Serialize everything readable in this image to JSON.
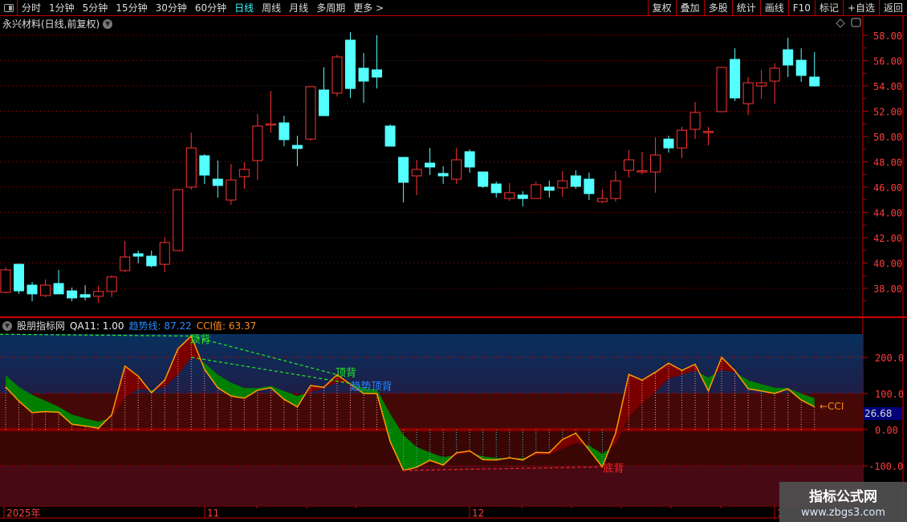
{
  "toolbar": {
    "periods": [
      "分时",
      "1分钟",
      "5分钟",
      "15分钟",
      "30分钟",
      "60分钟",
      "日线",
      "周线",
      "月线",
      "多周期",
      "更多 >"
    ],
    "active_period": "日线",
    "buttons": [
      "复权",
      "叠加",
      "多股",
      "统计",
      "画线",
      "F10",
      "标记",
      "+自选",
      "返回"
    ]
  },
  "main": {
    "title": "永兴材料(日线,前复权)"
  },
  "indicator": {
    "name": "股朋指标网",
    "qa_label": "QA11: 1.00",
    "trend_label": "趋势线: 87.22",
    "cci_label": "CCI值: 63.37",
    "cci_tag": "←CCI",
    "cursor_value": "26.68"
  },
  "xaxis": {
    "labels": [
      "2025年",
      "11",
      "12",
      "1"
    ]
  },
  "watermark": {
    "title": "指标公式网",
    "url": "www.zbgs3.com"
  },
  "colors": {
    "up": "#ff3333",
    "down": "#54ffff",
    "trend_up_fill": "#7a0000",
    "trend_down_fill": "#008000",
    "cci_line": "#ff9900"
  },
  "chart_data": [
    {
      "type": "candlestick",
      "title": "永兴材料(日线,前复权)",
      "ylim": [
        36,
        59
      ],
      "yticks": [
        38,
        40,
        42,
        44,
        46,
        48,
        50,
        52,
        54,
        56,
        58
      ],
      "ytick_labels": [
        "38.00",
        "40.00",
        "42.00",
        "44.00",
        "46.00",
        "48.00",
        "50.00",
        "52.00",
        "54.00",
        "56.00",
        "58.00"
      ],
      "ohlc": [
        [
          37.68,
          39.65,
          37.6,
          39.46
        ],
        [
          39.9,
          39.97,
          37.56,
          37.8
        ],
        [
          38.25,
          38.5,
          36.98,
          37.56
        ],
        [
          37.43,
          38.7,
          37.3,
          38.25
        ],
        [
          38.38,
          39.46,
          37.56,
          37.56
        ],
        [
          37.8,
          38.06,
          36.98,
          37.24
        ],
        [
          37.5,
          38.25,
          37.05,
          37.3
        ],
        [
          37.37,
          38.2,
          36.86,
          37.75
        ],
        [
          37.75,
          39.02,
          37.3,
          38.9
        ],
        [
          39.4,
          41.75,
          39.27,
          40.48
        ],
        [
          40.73,
          40.98,
          39.97,
          40.54
        ],
        [
          40.54,
          40.98,
          39.65,
          39.78
        ],
        [
          39.9,
          42.06,
          39.27,
          41.62
        ],
        [
          40.98,
          45.8,
          40.92,
          45.8
        ],
        [
          46.0,
          50.3,
          45.8,
          49.1
        ],
        [
          48.48,
          48.6,
          46.25,
          46.95
        ],
        [
          46.63,
          48.1,
          45.17,
          46.13
        ],
        [
          44.98,
          47.84,
          44.6,
          46.57
        ],
        [
          46.83,
          47.97,
          45.87,
          47.4
        ],
        [
          48.1,
          51.78,
          46.57,
          50.83
        ],
        [
          50.9,
          53.6,
          50.3,
          51.0
        ],
        [
          51.08,
          51.65,
          49.24,
          49.75
        ],
        [
          49.3,
          50.06,
          47.65,
          49.05
        ],
        [
          49.8,
          53.94,
          49.68,
          53.94
        ],
        [
          53.68,
          55.46,
          51.65,
          51.65
        ],
        [
          53.43,
          56.48,
          53.17,
          56.29
        ],
        [
          57.62,
          58.25,
          53.05,
          53.8
        ],
        [
          55.4,
          56.6,
          52.67,
          54.38
        ],
        [
          55.27,
          58.0,
          53.8,
          54.7
        ],
        [
          50.83,
          50.95,
          49.24,
          49.24
        ],
        [
          48.35,
          48.35,
          44.79,
          46.38
        ],
        [
          46.89,
          48.16,
          45.37,
          47.4
        ],
        [
          47.9,
          49.1,
          46.95,
          47.59
        ],
        [
          47.08,
          47.65,
          46.25,
          46.89
        ],
        [
          46.63,
          49.1,
          46.25,
          48.16
        ],
        [
          48.8,
          48.98,
          47.14,
          47.59
        ],
        [
          47.2,
          47.2,
          45.94,
          46.06
        ],
        [
          46.25,
          46.44,
          45.17,
          45.56
        ],
        [
          45.1,
          46.32,
          44.92,
          45.56
        ],
        [
          45.37,
          45.68,
          44.48,
          45.1
        ],
        [
          45.1,
          46.44,
          45.1,
          46.19
        ],
        [
          46.0,
          46.5,
          45.17,
          45.75
        ],
        [
          45.94,
          47.27,
          45.24,
          46.5
        ],
        [
          46.89,
          47.33,
          45.87,
          46.06
        ],
        [
          46.63,
          47.14,
          44.98,
          45.49
        ],
        [
          44.86,
          45.8,
          44.73,
          45.1
        ],
        [
          45.1,
          47.27,
          44.86,
          46.5
        ],
        [
          47.33,
          48.92,
          46.76,
          48.16
        ],
        [
          47.25,
          48.8,
          47.0,
          47.29
        ],
        [
          47.2,
          49.94,
          45.56,
          48.54
        ],
        [
          49.8,
          50.06,
          48.73,
          49.1
        ],
        [
          49.1,
          50.76,
          48.29,
          50.5
        ],
        [
          50.57,
          52.73,
          49.8,
          51.9
        ],
        [
          50.36,
          50.76,
          49.3,
          50.4
        ],
        [
          51.97,
          55.46,
          51.97,
          55.46
        ],
        [
          56.1,
          56.98,
          52.8,
          53.05
        ],
        [
          52.6,
          54.7,
          51.7,
          54.25
        ],
        [
          54.0,
          55.27,
          52.98,
          54.25
        ],
        [
          54.38,
          55.78,
          52.6,
          55.4
        ],
        [
          56.86,
          57.81,
          54.7,
          55.65
        ],
        [
          56.03,
          56.98,
          54.32,
          54.83
        ],
        [
          54.7,
          56.67,
          53.94,
          54.0
        ]
      ]
    },
    {
      "type": "line",
      "title": "股朋指标网 QA11",
      "ylim": [
        -210,
        265
      ],
      "yticks": [
        200,
        100,
        0,
        -100
      ],
      "ytick_labels": [
        "200.0",
        "100.0",
        "0.00",
        "-100.0"
      ],
      "series": [
        {
          "name": "CCI值",
          "values": [
            118,
            79,
            47,
            50,
            48,
            15,
            10,
            4,
            41,
            176,
            148,
            102,
            137,
            224,
            259,
            167,
            116,
            93,
            87,
            109,
            116,
            84,
            63,
            122,
            117,
            152,
            126,
            100,
            100,
            -33,
            -113,
            -104,
            -85,
            -98,
            -64,
            -59,
            -83,
            -84,
            -78,
            -84,
            -63,
            -64,
            -27,
            -10,
            -56,
            -103,
            -10,
            153,
            137,
            159,
            184,
            164,
            181,
            107,
            200,
            163,
            113,
            107,
            100,
            113,
            82,
            63.37
          ]
        },
        {
          "name": "趋势线",
          "values": [
            151,
            118,
            96,
            80,
            63,
            42,
            31,
            22,
            33,
            89,
            113,
            109,
            118,
            152,
            200,
            185,
            152,
            130,
            115,
            115,
            121,
            107,
            93,
            104,
            115,
            131,
            128,
            115,
            111,
            44,
            -15,
            -48,
            -63,
            -76,
            -70,
            -63,
            -74,
            -78,
            -79,
            -79,
            -70,
            -69,
            -52,
            -37,
            -44,
            -67,
            -40,
            37,
            74,
            104,
            141,
            152,
            163,
            144,
            165,
            159,
            137,
            126,
            116,
            115,
            100,
            87.22
          ]
        }
      ],
      "annotations": [
        {
          "text": "顶背",
          "kind": "top-div",
          "from": [
            -1,
            264
          ],
          "to": [
            14,
            259
          ],
          "color": "#22ee22"
        },
        {
          "text": "顶背",
          "kind": "top-div",
          "from": [
            14,
            259
          ],
          "to": [
            25,
            152
          ],
          "color": "#22ee22"
        },
        {
          "text": "趋势顶背",
          "kind": "trend-div",
          "from": [
            14,
            200
          ],
          "to": [
            26,
            128
          ],
          "color": "#2288ff"
        },
        {
          "text": "底背",
          "kind": "bottom-div",
          "from": [
            30,
            -113
          ],
          "to": [
            45,
            -103
          ],
          "color": "#ff2222"
        }
      ]
    }
  ]
}
